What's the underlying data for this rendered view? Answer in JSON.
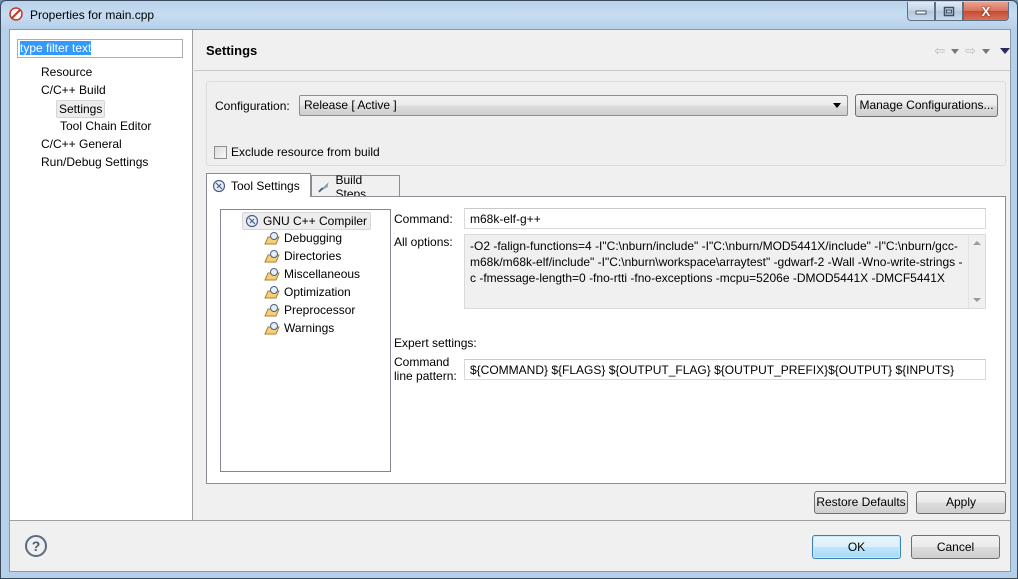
{
  "window": {
    "title": "Properties for main.cpp",
    "controls": {
      "minimize": "minimize",
      "maximize": "maximize",
      "close": "X"
    }
  },
  "sidebar": {
    "filter_text": "type filter text",
    "items": [
      {
        "label": "Resource",
        "level": 0
      },
      {
        "label": "C/C++ Build",
        "level": 0
      },
      {
        "label": "Settings",
        "level": 1,
        "selected": true
      },
      {
        "label": "Tool Chain Editor",
        "level": 1
      },
      {
        "label": "C/C++ General",
        "level": 0
      },
      {
        "label": "Run/Debug Settings",
        "level": 0
      }
    ]
  },
  "page": {
    "title": "Settings",
    "nav": {
      "back": "⇦",
      "forward": "⇨"
    }
  },
  "configuration": {
    "label": "Configuration:",
    "value": "Release  [ Active ]",
    "manage_button": "Manage Configurations...",
    "exclude_label": "Exclude resource from build",
    "exclude_checked": false
  },
  "tabs": [
    {
      "label": "Tool Settings",
      "active": true
    },
    {
      "label": "Build Steps",
      "active": false
    }
  ],
  "tool_tree": {
    "root": "GNU C++ Compiler",
    "children": [
      "Debugging",
      "Directories",
      "Miscellaneous",
      "Optimization",
      "Preprocessor",
      "Warnings"
    ]
  },
  "tool_settings": {
    "command_label": "Command:",
    "command_value": "m68k-elf-g++",
    "all_options_label": "All options:",
    "all_options_value": "-O2 -falign-functions=4 -I\"C:\\nburn/include\" -I\"C:\\nburn/MOD5441X/include\" -I\"C:\\nburn/gcc-m68k/m68k-elf/include\" -I\"C:\\nburn\\workspace\\arraytest\" -gdwarf-2 -Wall -Wno-write-strings -c -fmessage-length=0 -fno-rtti -fno-exceptions -mcpu=5206e -DMOD5441X -DMCF5441X",
    "expert_label": "Expert settings:",
    "pattern_label_1": "Command",
    "pattern_label_2": "line pattern:",
    "pattern_value": "${COMMAND} ${FLAGS} ${OUTPUT_FLAG} ${OUTPUT_PREFIX}${OUTPUT} ${INPUTS}"
  },
  "buttons": {
    "restore_defaults": "Restore Defaults",
    "apply": "Apply",
    "ok": "OK",
    "cancel": "Cancel",
    "help": "?"
  }
}
